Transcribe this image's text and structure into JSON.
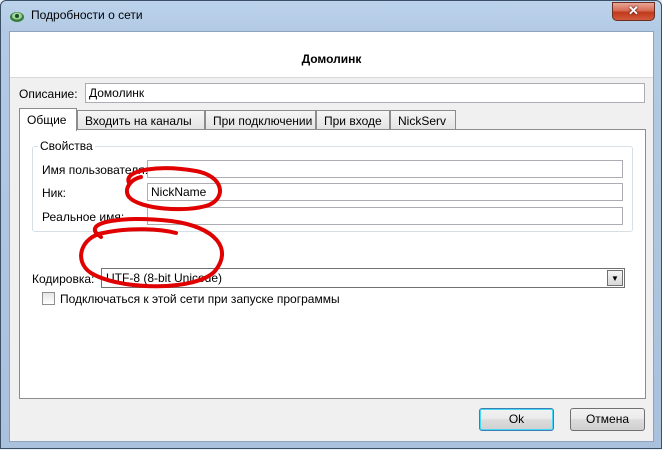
{
  "window": {
    "title": "Подробности о сети",
    "close_label": "✕"
  },
  "header": {
    "network_name": "Домолинк"
  },
  "description": {
    "label": "Описание:",
    "value": "Домолинк"
  },
  "tabs": [
    {
      "label": "Общие",
      "active": true
    },
    {
      "label": "Входить на каналы",
      "active": false
    },
    {
      "label": "При подключении",
      "active": false
    },
    {
      "label": "При входе",
      "active": false
    },
    {
      "label": "NickServ",
      "active": false
    }
  ],
  "properties": {
    "group_title": "Свойства",
    "username_label": "Имя пользователя:",
    "username_value": "",
    "nick_label": "Ник:",
    "nick_value": "NickName",
    "realname_label": "Реальное имя:",
    "realname_value": ""
  },
  "encoding": {
    "label": "Кодировка:",
    "value": "UTF-8 (8-bit Unicode)"
  },
  "autoconnect": {
    "label": "Подключаться к этой сети при запуске программы",
    "checked": false
  },
  "buttons": {
    "ok": "Ok",
    "cancel": "Отмена"
  },
  "colors": {
    "annotation": "#e00000"
  }
}
